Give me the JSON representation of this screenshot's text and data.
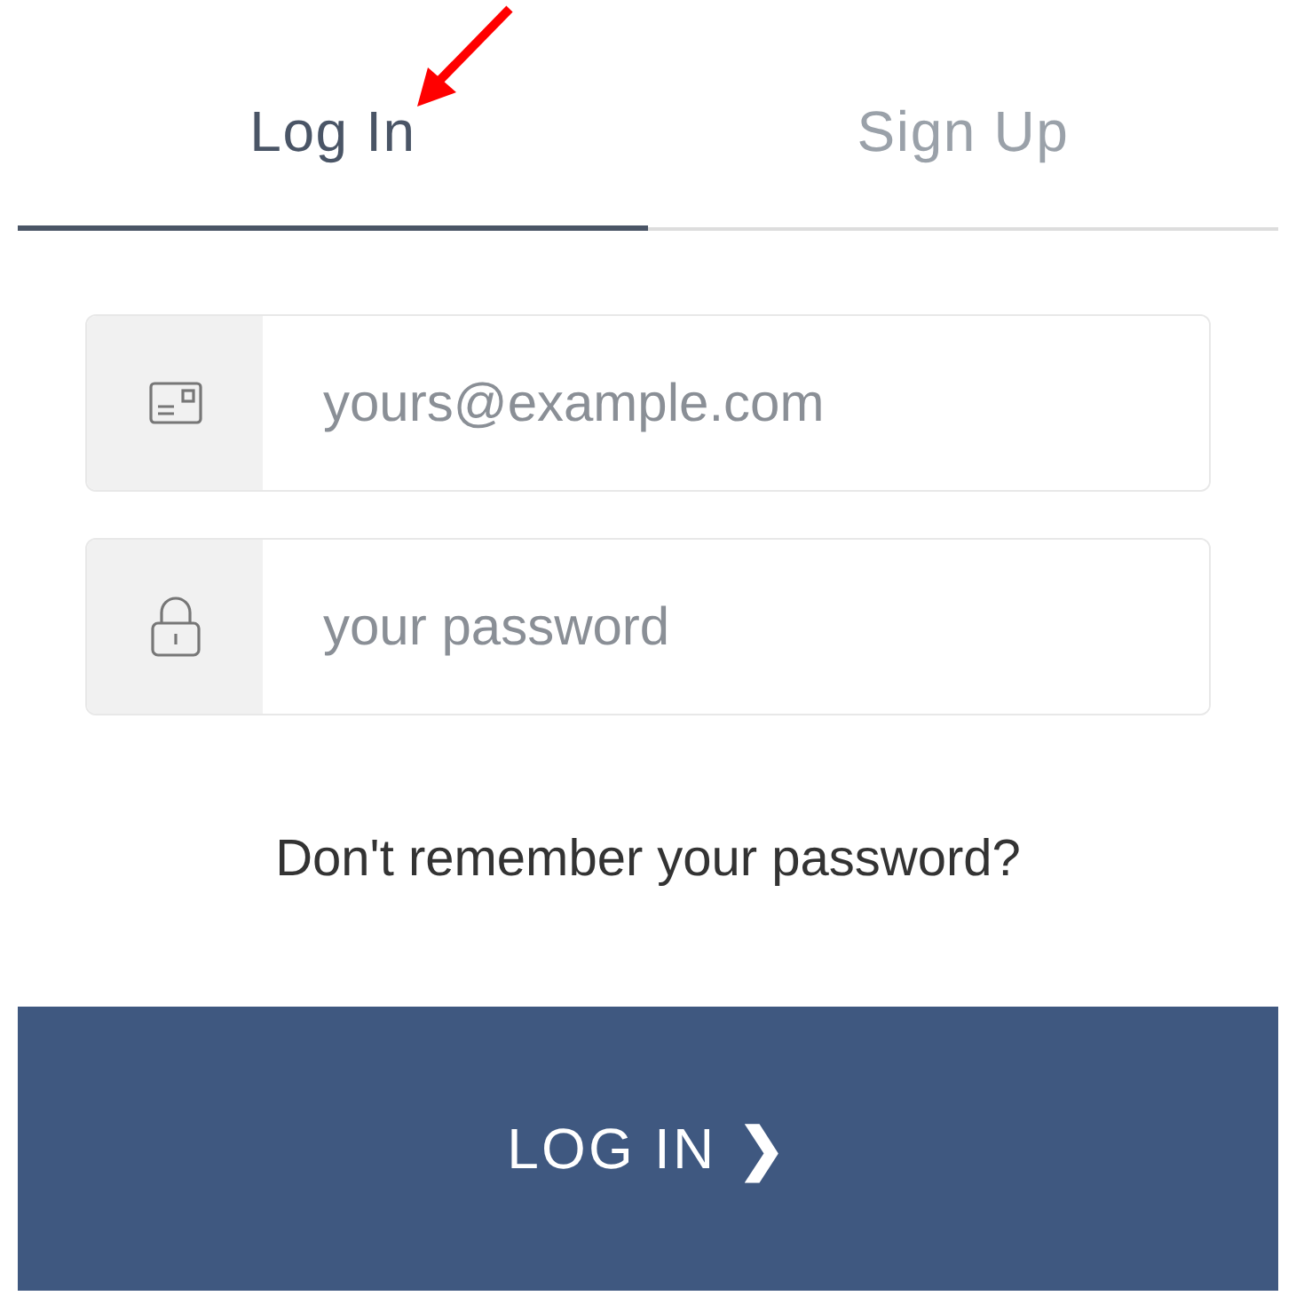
{
  "tabs": [
    {
      "label": "Log In",
      "selected": true
    },
    {
      "label": "Sign Up",
      "selected": false
    }
  ],
  "fields": [
    {
      "kind": "email",
      "placeholder": "yours@example.com"
    },
    {
      "kind": "password",
      "placeholder": "your password"
    }
  ],
  "forgot_link": "Don't remember your password?",
  "submit": {
    "label": "LOG IN",
    "icon": "❯"
  }
}
